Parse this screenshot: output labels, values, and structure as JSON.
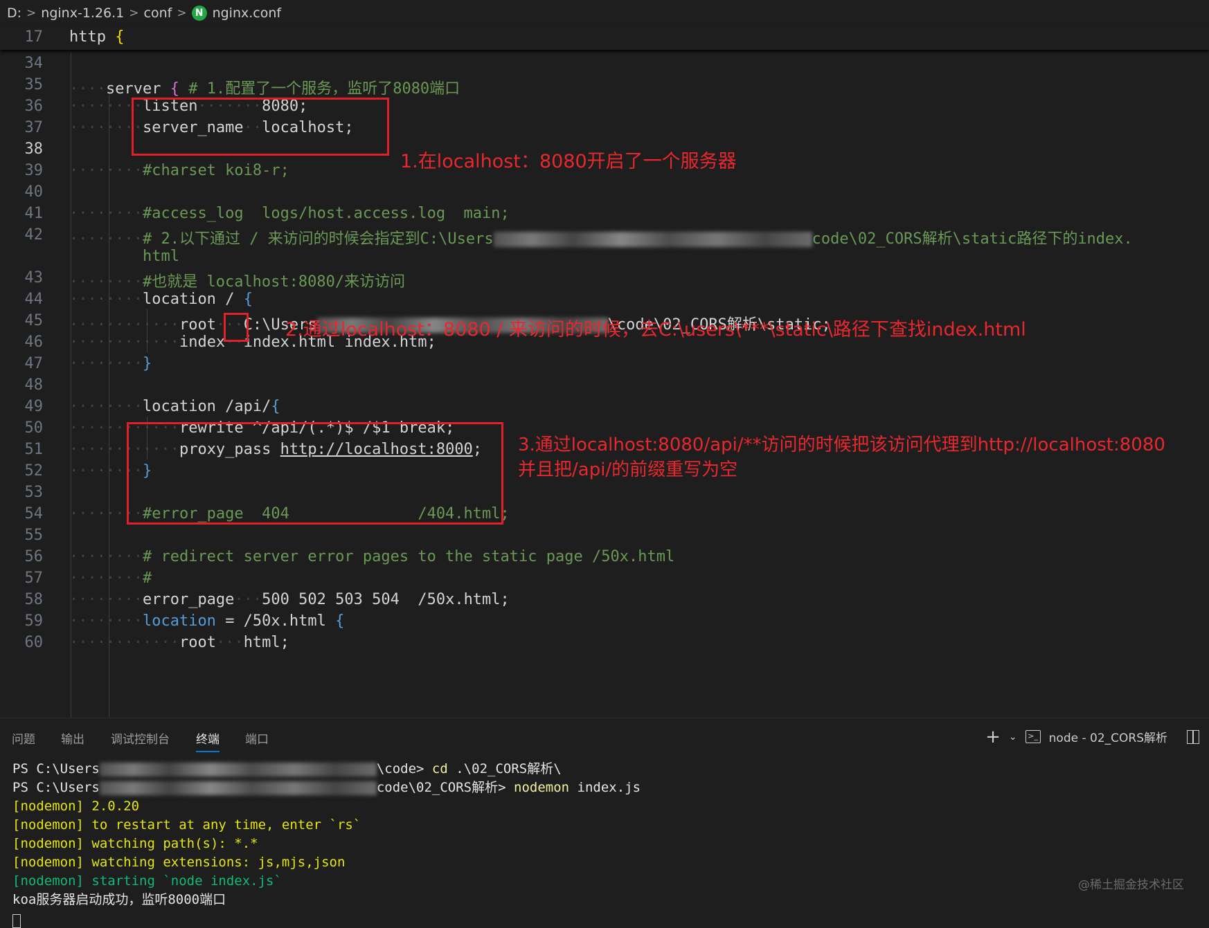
{
  "breadcrumb": {
    "drive": "D:",
    "folder": "nginx-1.26.1",
    "sub": "conf",
    "file": "nginx.conf",
    "file_icon_letter": "N"
  },
  "sticky": {
    "line_no": "17",
    "keyword": "http",
    "brace": "{"
  },
  "lines": [
    {
      "n": "34"
    },
    {
      "n": "35"
    },
    {
      "n": "36"
    },
    {
      "n": "37"
    },
    {
      "n": "38"
    },
    {
      "n": "39"
    },
    {
      "n": "40"
    },
    {
      "n": "41"
    },
    {
      "n": "42"
    },
    {
      "n": ""
    },
    {
      "n": "43"
    },
    {
      "n": "44"
    },
    {
      "n": "45"
    },
    {
      "n": "46"
    },
    {
      "n": "47"
    },
    {
      "n": "48"
    },
    {
      "n": "49"
    },
    {
      "n": "50"
    },
    {
      "n": "51"
    },
    {
      "n": "52"
    },
    {
      "n": "53"
    },
    {
      "n": "54"
    },
    {
      "n": "55"
    },
    {
      "n": "56"
    },
    {
      "n": "57"
    },
    {
      "n": "58"
    },
    {
      "n": "59"
    },
    {
      "n": "60"
    }
  ],
  "code": {
    "l35_kw": "server",
    "l35_brace": "{",
    "l35_cmt": "# 1.配置了一个服务，监听了8080端口",
    "l36_kw": "listen",
    "l36_val": "8080;",
    "l37_kw": "server_name",
    "l37_val": "localhost;",
    "l39": "#charset koi8-r;",
    "l41": "#access_log  logs/host.access.log  main;",
    "l42a": "# 2.以下通过 / 来访问的时候会指定到C:\\Users",
    "l42b": "code\\02_CORS解析\\static路径下的index.",
    "l42c": "html",
    "l43": "#也就是 localhost:8080/来访访问",
    "l44_kw": "location",
    "l44_path": "/",
    "l44_brace": "{",
    "l45_kw": "root",
    "l45_a": "C:\\Users",
    "l45_b": "\\code\\02_CORS解析\\static;",
    "l46_kw": "index",
    "l46_val": "index.html index.htm;",
    "l47": "}",
    "l49_kw": "location /api/",
    "l49_brace": "{",
    "l50_kw": "rewrite",
    "l50_val": "^/api/(.*)$ /$1 break;",
    "l51_kw": "proxy_pass",
    "l51_url": "http://localhost:8000",
    "l51_end": ";",
    "l52": "}",
    "l54": "#error_page  404              /404.html;",
    "l56": "# redirect server error pages to the static page /50x.html",
    "l57": "#",
    "l58_kw": "error_page",
    "l58_val": "500 502 503 504  /50x.html;",
    "l59_kw": "location",
    "l59_val": "= /50x.html",
    "l59_brace": "{",
    "l60_kw": "root",
    "l60_val": "html;"
  },
  "annotations": {
    "a1": "1.在localhost：8080开启了一个服务器",
    "a2": "2.通过localhost：8080 / 来访问的时候，去C:\\users\\***\\static\\路径下查找index.html",
    "a3_line1": "3.通过localhost:8080/api/**访问的时候把该访问代理到http://localhost:8080",
    "a3_line2": "并且把/api/的前缀重写为空"
  },
  "panel": {
    "tabs": [
      "问题",
      "输出",
      "调试控制台",
      "终端",
      "端口"
    ],
    "active_tab": "终端",
    "terminal_name": "node - 02_CORS解析"
  },
  "terminal": {
    "l1_prompt": "PS C:\\Users",
    "l1_rest": "\\code> ",
    "l1_cmd": "cd",
    "l1_arg": " .\\02_CORS解析\\",
    "l2_prompt": "PS C:\\Users",
    "l2_rest": "code\\02_CORS解析> ",
    "l2_cmd": "nodemon",
    "l2_arg": " index.js",
    "l3": "[nodemon] 2.0.20",
    "l4": "[nodemon] to restart at any time, enter `rs`",
    "l5": "[nodemon] watching path(s): *.*",
    "l6": "[nodemon] watching extensions: js,mjs,json",
    "l7": "[nodemon] starting `node index.js`",
    "l8": "koa服务器启动成功，监听8000端口"
  },
  "watermark": "@稀土掘金技术社区",
  "colors": {
    "background": "#1e1e1e",
    "annotation": "#e8282e",
    "comment": "#6a9955",
    "keyword_blue": "#569cd6"
  }
}
